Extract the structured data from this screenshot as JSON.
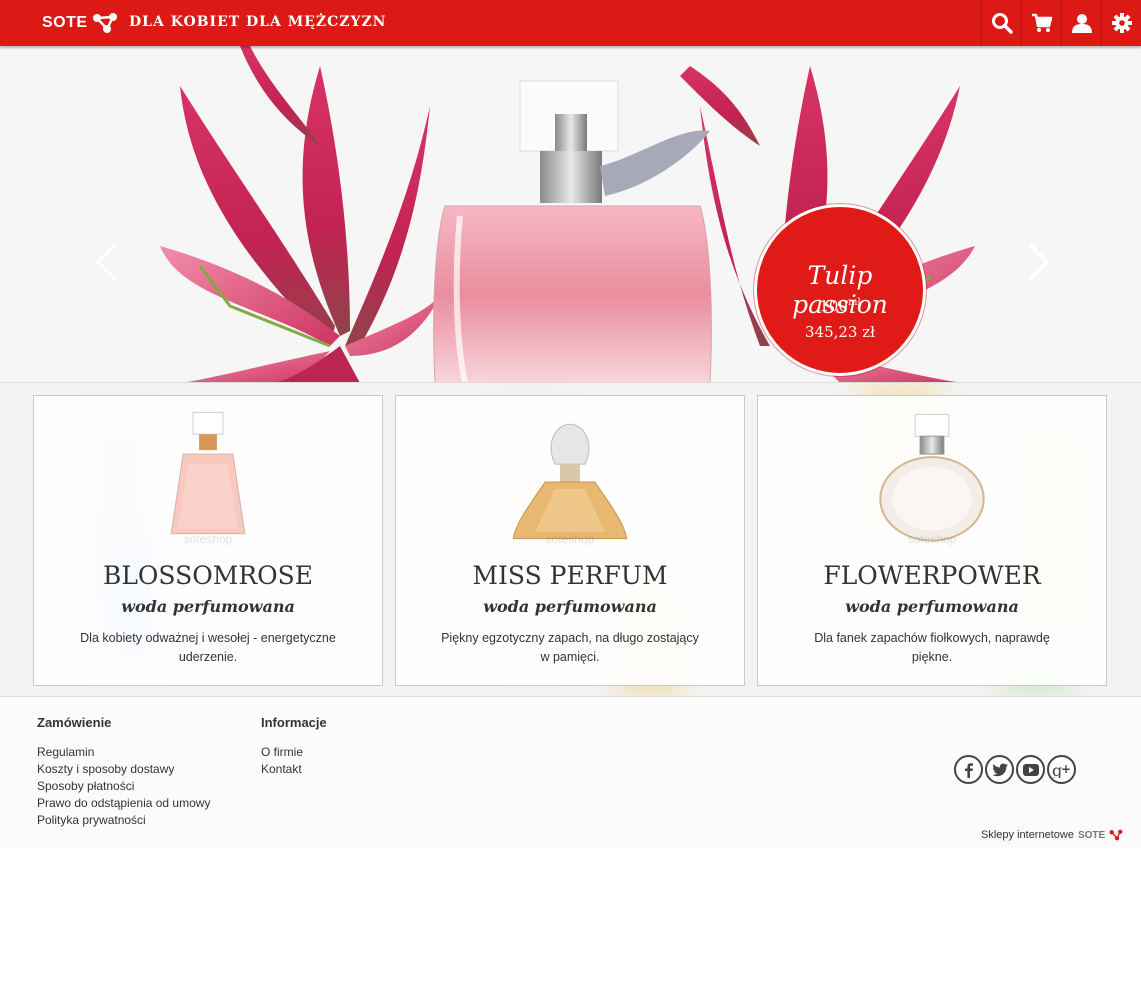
{
  "header": {
    "logo_text": "SOTE",
    "nav": [
      "DLA KOBIET",
      "DLA MĘŻCZYZN"
    ],
    "icons": [
      "search-icon",
      "cart-icon",
      "user-icon",
      "settings-icon"
    ],
    "color": "#dc1915"
  },
  "hero": {
    "promo_title": "Tulip passion",
    "promo_volume": "100",
    "promo_unit": "ml",
    "promo_price": "345,23 zł",
    "prev_icon": "chevron-left-icon",
    "next_icon": "chevron-right-icon"
  },
  "products": [
    {
      "name": "BLOSSOMROSE",
      "subtitle": "woda perfumowana",
      "description": "Dla kobiety odważnej i wesołej - energetyczne uderzenie.",
      "watermark": "soteshop"
    },
    {
      "name": "MISS PERFUM",
      "subtitle": "woda perfumowana",
      "description": "Piękny egzotyczny zapach, na długo zostający w pamięci.",
      "watermark": "soteshop"
    },
    {
      "name": "FLOWERPOWER",
      "subtitle": "woda perfumowana",
      "description": "Dla fanek zapachów fiołkowych, naprawdę piękne.",
      "watermark": "soteshop"
    }
  ],
  "footer": {
    "col1": {
      "title": "Zamówienie",
      "links": [
        "Regulamin",
        "Koszty i sposoby dostawy",
        "Sposoby płatności",
        "Prawo do odstąpienia od umowy",
        "Polityka prywatności"
      ]
    },
    "col2": {
      "title": "Informacje",
      "links": [
        "O firmie",
        "Kontakt"
      ]
    },
    "social": [
      "facebook-icon",
      "twitter-icon",
      "youtube-icon",
      "google-plus-icon"
    ],
    "powered_text": "Sklepy internetowe",
    "powered_logo": "SOTE"
  }
}
